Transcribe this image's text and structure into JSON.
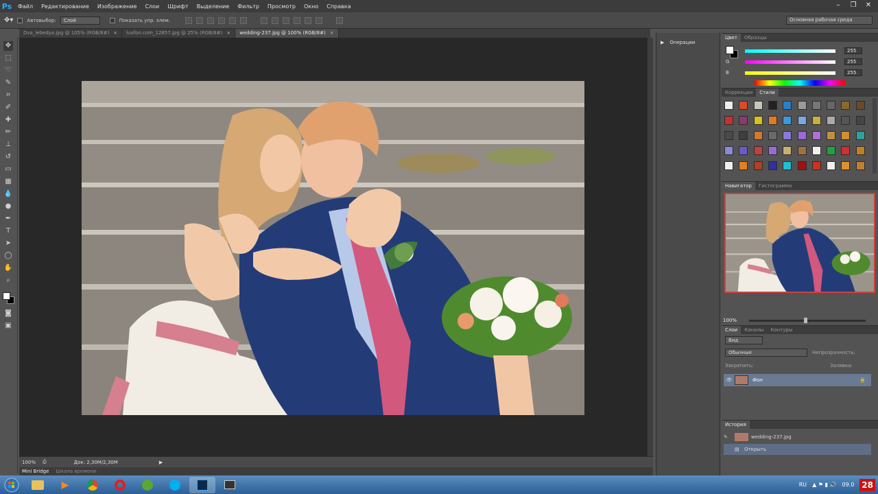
{
  "app": {
    "logo": "Ps"
  },
  "menu": [
    "Файл",
    "Редактирование",
    "Изображение",
    "Слои",
    "Шрифт",
    "Выделение",
    "Фильтр",
    "Просмотр",
    "Окно",
    "Справка"
  ],
  "options": {
    "autoselect_label": "Автовыбор:",
    "autoselect_value": "Слой",
    "show_transform_label": "Показать упр. элем.",
    "workspace": "Основная рабочая среда"
  },
  "doc_tabs": [
    {
      "label": "Dva_lebedya.jpg @ 105% (RGB/8#)",
      "close": "×"
    },
    {
      "label": "luxfon.com_12857.jpg @ 25% (RGB/8#)",
      "close": "×"
    },
    {
      "label": "wedding-237.jpg @ 100% (RGB/8#)",
      "close": "×"
    }
  ],
  "status": {
    "zoom": "100%",
    "doc_size": "Док: 2,30M/2,30M"
  },
  "bottom_tabs": {
    "minibridge": "Mini Bridge",
    "timeline": "Шкала времени"
  },
  "actions_panel": {
    "label": "Операции"
  },
  "color_panel": {
    "tabs": [
      "Цвет",
      "Образцы"
    ],
    "r_label": "R",
    "r_value": "255",
    "g_label": "G",
    "g_value": "255",
    "b_label": "B",
    "b_value": "255"
  },
  "styles_panel": {
    "tabs": [
      "Коррекция",
      "Стили"
    ]
  },
  "navigator_panel": {
    "tabs": [
      "Навигатор",
      "Гистограмма"
    ],
    "zoom": "100%"
  },
  "layers_panel": {
    "tabs": [
      "Слои",
      "Каналы",
      "Контуры"
    ],
    "filter": "Вид",
    "blend_mode": "Обычные",
    "opacity_label": "Непрозрачность:",
    "lock_label": "Закрепить:",
    "fill_label": "Заливка:",
    "layer_name": "Фон"
  },
  "history_panel": {
    "tab": "История",
    "snapshot": "wedding-237.jpg",
    "step": "Открыть"
  },
  "taskbar": {
    "lang": "RU",
    "clock": "28",
    "date": "09.0"
  }
}
